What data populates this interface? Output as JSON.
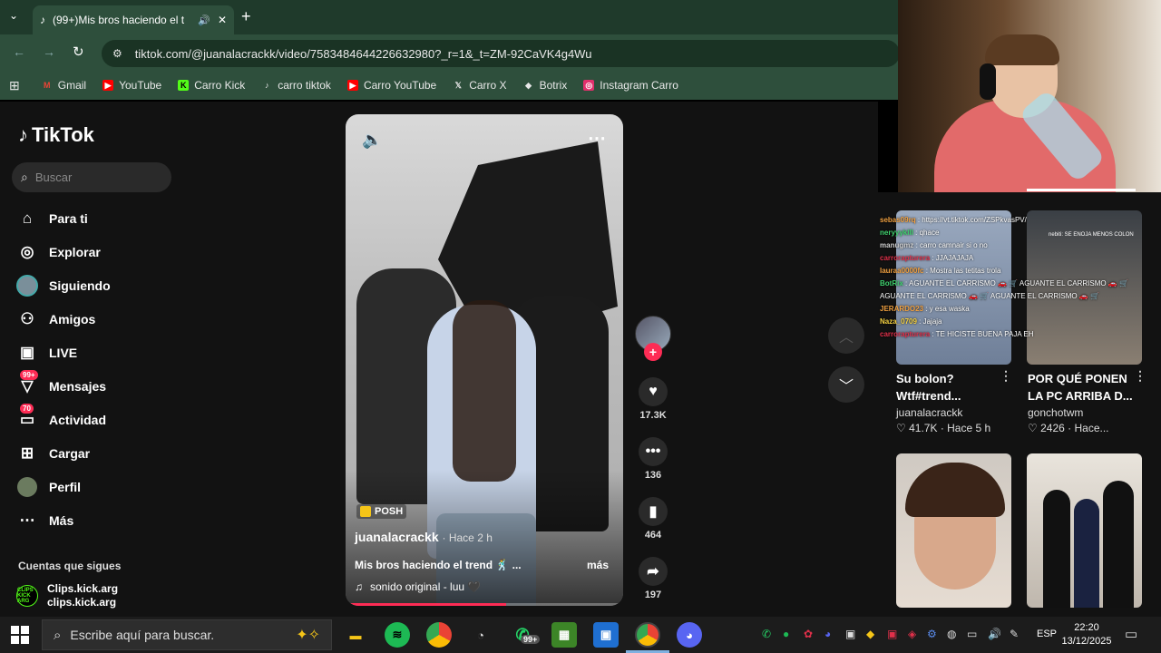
{
  "browser": {
    "tab_title": "(99+)Mis bros haciendo el t",
    "new_tab": "+",
    "url": "tiktok.com/@juanalacrackk/video/7583484644226632980?_r=1&_t=ZM-92CaVK4g4Wu",
    "bookmarks": [
      {
        "label": "Gmail",
        "icon": "gmail-icon",
        "color": "#ea4335"
      },
      {
        "label": "YouTube",
        "icon": "youtube-icon",
        "color": "#ff0000"
      },
      {
        "label": "Carro Kick",
        "icon": "kick-icon",
        "color": "#53fc18"
      },
      {
        "label": "carro tiktok",
        "icon": "tiktok-icon",
        "color": "#ffffff"
      },
      {
        "label": "Carro YouTube",
        "icon": "youtube-icon",
        "color": "#ff0000"
      },
      {
        "label": "Carro X",
        "icon": "x-icon",
        "color": "#ffffff"
      },
      {
        "label": "Botrix",
        "icon": "botrix-icon",
        "color": "#ffffff"
      },
      {
        "label": "Instagram Carro",
        "icon": "instagram-icon",
        "color": "#e1306c"
      }
    ]
  },
  "tiktok": {
    "logo": "TikTok",
    "search_placeholder": "Buscar",
    "nav": [
      {
        "label": "Para ti",
        "icon": "home-icon"
      },
      {
        "label": "Explorar",
        "icon": "compass-icon"
      },
      {
        "label": "Siguiendo",
        "icon": "following-avatar-icon"
      },
      {
        "label": "Amigos",
        "icon": "friends-icon"
      },
      {
        "label": "LIVE",
        "icon": "live-icon"
      },
      {
        "label": "Mensajes",
        "icon": "messages-icon",
        "badge": "99+"
      },
      {
        "label": "Actividad",
        "icon": "activity-icon",
        "badge": "70"
      },
      {
        "label": "Cargar",
        "icon": "upload-icon"
      },
      {
        "label": "Perfil",
        "icon": "profile-avatar-icon"
      },
      {
        "label": "Más",
        "icon": "more-icon"
      }
    ],
    "following_title": "Cuentas que sigues",
    "following": {
      "name": "Clips.kick.arg",
      "handle": "clips.kick.arg",
      "avatar_text": "CLIPS KICK ARG"
    }
  },
  "video": {
    "sticker": "POSH",
    "author": "juanalacrackk",
    "time": "· Hace 2 h",
    "description": "Mis bros haciendo el trend 🕺 ...",
    "more": "más",
    "sound": "sonido original - luu 🖤",
    "progress": 0.58,
    "likes": "17.3K",
    "comments": "136",
    "saves": "464",
    "shares": "197"
  },
  "chat": [
    {
      "user": "sebas09rq",
      "color": "#f0a040",
      "msg": ": https://vt.tiktok.com/ZSPkvasPV/"
    },
    {
      "user": "neryyyklll",
      "color": "#3fd16e",
      "msg": ": qhace"
    },
    {
      "user": "manugmz",
      "color": "#cfcfcf",
      "msg": ": carro camnair si o no"
    },
    {
      "user": "carrorapturera",
      "color": "#e0304a",
      "msg": ": JJAJAJAJA"
    },
    {
      "user": "lauraa0000fc",
      "color": "#f0a040",
      "msg": ": Mostra las tetitas trola"
    },
    {
      "user": "BotRix",
      "color": "#3fd16e",
      "msg": ": AGUANTE EL CARRISMO 🚗 🛒 AGUANTE EL CARRISMO 🚗 🛒 AGUANTE EL CARRISMO 🚗 🛒 AGUANTE EL CARRISMO 🚗 🛒"
    },
    {
      "user": "JERARDO23",
      "color": "#f0a040",
      "msg": ": y esa waska"
    },
    {
      "user": "Naza_0709",
      "color": "#f5d142",
      "msg": ": Jajaja"
    },
    {
      "user": "carrorapturera",
      "color": "#e0304a",
      "msg": ": TE HICISTE BUENA PAJA EH"
    }
  ],
  "related": [
    {
      "title": "Su bolon? Wtf#trend...",
      "author": "juanalacrackk",
      "likes": "41.7K",
      "time": "· Hace 5 h",
      "overlay": ""
    },
    {
      "title": "POR QUÉ PONEN LA PC ARRIBA D...",
      "author": "gonchotwm",
      "likes": "2426",
      "time": "· Hace...",
      "overlay": "nebiti: SE ENOJA MENOS COLON"
    }
  ],
  "taskbar": {
    "search_placeholder": "Escribe aquí para buscar.",
    "whatsapp_badge": "99+",
    "lang": "ESP",
    "time": "22:20",
    "date": "13/12/2025"
  }
}
